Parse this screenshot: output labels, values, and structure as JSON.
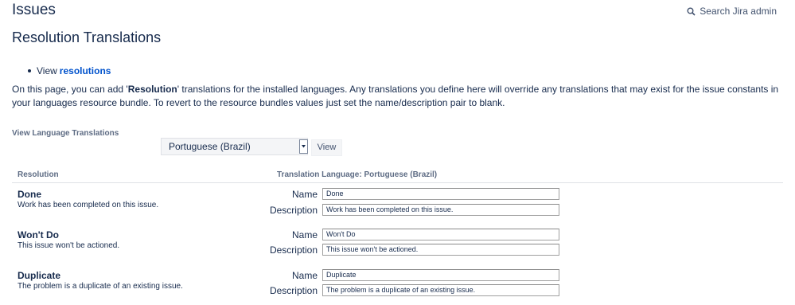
{
  "header": {
    "title": "Issues",
    "search_label": "Search Jira admin"
  },
  "page": {
    "title": "Resolution Translations",
    "view_prefix": "View",
    "view_link": "resolutions",
    "description_1": "On this page, you can add '",
    "description_bold": "Resolution",
    "description_2": "' translations for the installed languages. Any translations you define here will override any translations that may exist for the issue constants in your languages resource bundle. To revert to the resource bundles values just set the name/description pair to blank."
  },
  "language": {
    "label": "View Language Translations",
    "selected": "Portuguese (Brazil)",
    "view_button": "View"
  },
  "table": {
    "col_resolution": "Resolution",
    "col_translation": "Translation Language: Portuguese (Brazil)",
    "name_label": "Name",
    "description_label": "Description",
    "rows": [
      {
        "name": "Done",
        "description": "Work has been completed on this issue.",
        "name_value": "Done",
        "description_value": "Work has been completed on this issue."
      },
      {
        "name": "Won't Do",
        "description": "This issue won't be actioned.",
        "name_value": "Won't Do",
        "description_value": "This issue won't be actioned."
      },
      {
        "name": "Duplicate",
        "description": "The problem is a duplicate of an existing issue.",
        "name_value": "Duplicate",
        "description_value": "The problem is a duplicate of an existing issue."
      }
    ]
  }
}
